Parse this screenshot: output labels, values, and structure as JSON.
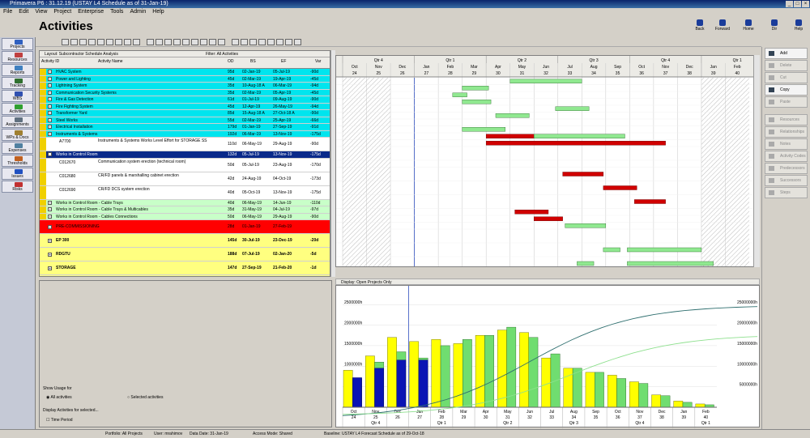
{
  "window": {
    "title": "Primavera P6 : 31.12.19 (USTAY L4 Schedule as of 31-Jan-19)"
  },
  "menu": [
    "File",
    "Edit",
    "View",
    "Project",
    "Enterprise",
    "Tools",
    "Admin",
    "Help"
  ],
  "page": {
    "title": "Activities"
  },
  "header_buttons": [
    {
      "label": "Back",
      "name": "back-button"
    },
    {
      "label": "Forward",
      "name": "forward-button"
    },
    {
      "label": "Home",
      "name": "home-button"
    },
    {
      "label": "Dir",
      "name": "directory-button"
    },
    {
      "label": "Help",
      "name": "help-button"
    }
  ],
  "nav": [
    {
      "label": "Projects",
      "color": "#3060c0"
    },
    {
      "label": "Resources",
      "color": "#c04040"
    },
    {
      "label": "Reports",
      "color": "#4080c0"
    },
    {
      "label": "Tracking",
      "color": "#307030"
    },
    {
      "label": "WBS",
      "color": "#3050b0"
    },
    {
      "label": "Activities",
      "color": "#30a030"
    },
    {
      "label": "Assignments",
      "color": "#607080"
    },
    {
      "label": "WPs & Docs",
      "color": "#a08030"
    },
    {
      "label": "Expenses",
      "color": "#5080a0"
    },
    {
      "label": "Thresholds",
      "color": "#c06020"
    },
    {
      "label": "Issues",
      "color": "#2050c0"
    },
    {
      "label": "Risks",
      "color": "#c03030"
    }
  ],
  "right_actions": [
    {
      "label": "Add",
      "enabled": true
    },
    {
      "label": "Delete",
      "enabled": false
    },
    {
      "label": "Cut",
      "enabled": false
    },
    {
      "label": "Copy",
      "enabled": true
    },
    {
      "label": "Paste",
      "enabled": false
    },
    {
      "label": "Resources",
      "enabled": false
    },
    {
      "label": "Relationships",
      "enabled": false
    },
    {
      "label": "Notes",
      "enabled": false
    },
    {
      "label": "Activity Codes",
      "enabled": false
    },
    {
      "label": "Predecessors",
      "enabled": false
    },
    {
      "label": "Successors",
      "enabled": false
    },
    {
      "label": "Steps",
      "enabled": false
    }
  ],
  "table": {
    "layout_label": "Layout: Subcontractor Schedule Analysis",
    "filter_label": "Filter: All Activities",
    "columns": [
      "Activity ID",
      "Activity Name",
      "OD",
      "BS",
      "EF",
      "Var"
    ],
    "rows": [
      {
        "id": "",
        "name": "HVAC System",
        "od": "95d",
        "bs": "02-Jan-19",
        "ef": "05-Jul-19",
        "var": "-90d",
        "bg": "#00e5ee",
        "stripe": "#f0d000"
      },
      {
        "id": "",
        "name": "Power and Lighting",
        "od": "45d",
        "bs": "02-Mar-19",
        "ef": "19-Apr-19",
        "var": "-45d",
        "bg": "#00e5ee",
        "stripe": "#f0d000"
      },
      {
        "id": "",
        "name": "Lightning System",
        "od": "35d",
        "bs": "10-Aug-18 A",
        "ef": "06-Mar-19",
        "var": "-94d",
        "bg": "#00e5ee",
        "stripe": "#f0d000"
      },
      {
        "id": "",
        "name": "Communication Security Systems",
        "od": "35d",
        "bs": "02-Mar-19",
        "ef": "05-Apr-19",
        "var": "-45d",
        "bg": "#00e5ee",
        "stripe": "#f0d000"
      },
      {
        "id": "",
        "name": "Fire & Gas Detection",
        "od": "61d",
        "bs": "01-Jul-19",
        "ef": "09-Aug-19",
        "var": "-90d",
        "bg": "#00e5ee",
        "stripe": "#f0d000"
      },
      {
        "id": "",
        "name": "Fire Fighting System",
        "od": "45d",
        "bs": "12-Apr-19",
        "ef": "26-May-19",
        "var": "-94d",
        "bg": "#00e5ee",
        "stripe": "#f0d000"
      },
      {
        "id": "",
        "name": "Transformer Yard",
        "od": "85d",
        "bs": "15-Aug-18 A",
        "ef": "27-Oct-18 A",
        "var": "-90d",
        "bg": "#00e5ee",
        "stripe": "#f0d000"
      },
      {
        "id": "",
        "name": "Steel Works",
        "od": "55d",
        "bs": "02-Mar-19",
        "ef": "25-Apr-19",
        "var": "-66d",
        "bg": "#00e5ee",
        "stripe": "#f0d000"
      },
      {
        "id": "",
        "name": "Electrical Installation",
        "od": "179d",
        "bs": "01-Jan-19",
        "ef": "27-Sep-19",
        "var": "-91d",
        "bg": "#00e5ee",
        "stripe": "#f0d000"
      },
      {
        "id": "",
        "name": "Instruments & Systems",
        "od": "192d",
        "bs": "06-Mar-19",
        "ef": "13-Nov-19",
        "var": "-175d",
        "bg": "#00e5ee",
        "stripe": "#f0d000"
      },
      {
        "id": "A7700",
        "name": "Instruments & Systems Works Level Effort for STORAGE SS",
        "od": "110d",
        "bs": "06-May-19",
        "ef": "29-Aug-19",
        "var": "-90d",
        "bg": "#ffffff",
        "stripe": "#f0d000",
        "tall": true
      },
      {
        "id": "",
        "name": "Works in Control Room",
        "od": "132d",
        "bs": "05-Jul-19",
        "ef": "13-Nov-19",
        "var": "-175d",
        "bg": "#0a2a8a",
        "stripe": "#f0d000",
        "dark": true
      },
      {
        "id": "C012670",
        "name": "Communication system erection (technical room)",
        "od": "50d",
        "bs": "05-Jul-19",
        "ef": "23-Aug-19",
        "var": "-170d",
        "bg": "#ffffff",
        "stripe": "#f0d000",
        "tall": true
      },
      {
        "id": "C012680",
        "name": "CR/FD panels & marshalling cabinet erection",
        "od": "42d",
        "bs": "24-Aug-19",
        "ef": "04-Oct-19",
        "var": "-173d",
        "bg": "#ffffff",
        "stripe": "#f0d000",
        "tall": true
      },
      {
        "id": "C012690",
        "name": "CR/FD DCS system erection",
        "od": "40d",
        "bs": "05-Oct-19",
        "ef": "13-Nov-19",
        "var": "-175d",
        "bg": "#ffffff",
        "stripe": "#f0d000",
        "tall": true
      },
      {
        "id": "",
        "name": "Works in Control Room - Cable Trays",
        "od": "40d",
        "bs": "06-May-19",
        "ef": "14-Jun-19",
        "var": "-110d",
        "bg": "#c8ffc8",
        "stripe": "#f0d000"
      },
      {
        "id": "",
        "name": "Works in Control Room - Cable Trays & Multicables",
        "od": "35d",
        "bs": "31-May-19",
        "ef": "04-Jul-19",
        "var": "-97d",
        "bg": "#c8ffc8",
        "stripe": "#f0d000"
      },
      {
        "id": "",
        "name": "Works in Control Room - Cables Connections",
        "od": "50d",
        "bs": "06-May-19",
        "ef": "29-Aug-19",
        "var": "-90d",
        "bg": "#c8ffc8",
        "stripe": "#f0d000"
      },
      {
        "id": "",
        "name": "PRE-COMMISSIONING",
        "od": "28d",
        "bs": "01-Jan-19",
        "ef": "27-Feb-19",
        "var": "",
        "bg": "#ff0000",
        "stripe": "#ff0000",
        "tall2": true
      },
      {
        "id": "",
        "name": "EP 300",
        "od": "145d",
        "bs": "30-Jul-19",
        "ef": "23-Dec-19",
        "var": "-20d",
        "bg": "#ffff80",
        "stripe": "#ffff80",
        "tall2": true,
        "bold": true
      },
      {
        "id": "",
        "name": "RDGTU",
        "od": "188d",
        "bs": "07-Jul-19",
        "ef": "02-Jan-20",
        "var": "-5d",
        "bg": "#ffff80",
        "stripe": "#ffff80",
        "tall2": true,
        "bold": true
      },
      {
        "id": "",
        "name": "STORAGE",
        "od": "147d",
        "bs": "27-Sep-19",
        "ef": "21-Feb-20",
        "var": "-1d",
        "bg": "#ffff80",
        "stripe": "#ffff80",
        "tall2": true,
        "bold": true
      },
      {
        "id": "",
        "name": "INTERCONNECTING PR EP300 - STORAGE",
        "od": "0d",
        "bs": "22-Sep-19",
        "ef": "22-Sep-19",
        "var": "",
        "bg": "#ffff80",
        "stripe": "#ffff80",
        "tall2": true,
        "bold": true
      }
    ]
  },
  "gantt": {
    "quarters": [
      "Qtr 4",
      "Qtr 1",
      "Qtr 2",
      "Qtr 3",
      "Qtr 4",
      "Qtr 1"
    ],
    "months": [
      "Oct",
      "Nov",
      "Dec",
      "Jan",
      "Feb",
      "Mar",
      "Apr",
      "May",
      "Jun",
      "Jul",
      "Aug",
      "Sep",
      "Oct",
      "Nov",
      "Dec",
      "Jan",
      "Feb"
    ],
    "weeks": [
      "24",
      "25",
      "26",
      "27",
      "28",
      "29",
      "30",
      "31",
      "32",
      "33",
      "34",
      "35",
      "36",
      "37",
      "38",
      "39",
      "40"
    ],
    "bars": [
      {
        "row": 0,
        "start": 7.0,
        "end": 10.0,
        "color": "#90e890"
      },
      {
        "row": 1,
        "start": 5.0,
        "end": 6.1,
        "color": "#90e890"
      },
      {
        "row": 2,
        "start": 4.6,
        "end": 5.2,
        "color": "#90e890"
      },
      {
        "row": 3,
        "start": 5.0,
        "end": 6.2,
        "color": "#90e890"
      },
      {
        "row": 4,
        "start": 8.9,
        "end": 10.3,
        "color": "#90e890"
      },
      {
        "row": 5,
        "start": 6.4,
        "end": 7.8,
        "color": "#90e890"
      },
      {
        "row": 7,
        "start": 5.0,
        "end": 6.8,
        "color": "#90e890"
      },
      {
        "row": 8,
        "start": 6.0,
        "end": 11.8,
        "color": "#90e890",
        "redUntil": 8.0
      },
      {
        "row": 9,
        "start": 6.0,
        "end": 13.5,
        "color": "#d00000"
      },
      {
        "row": 12,
        "start": 9.2,
        "end": 10.9,
        "color": "#d00000"
      },
      {
        "row": 13,
        "start": 10.9,
        "end": 12.3,
        "color": "#d00000"
      },
      {
        "row": 14,
        "start": 12.2,
        "end": 13.5,
        "color": "#d00000"
      },
      {
        "row": 15,
        "start": 7.2,
        "end": 8.6,
        "color": "#d00000"
      },
      {
        "row": 16,
        "start": 8.0,
        "end": 9.2,
        "color": "#d00000"
      },
      {
        "row": 17,
        "start": 9.3,
        "end": 11.0,
        "color": "#90e890"
      },
      {
        "row": 19,
        "start": 10.9,
        "end": 11.6,
        "color": "#90e890"
      },
      {
        "row": 19,
        "start": 11.9,
        "end": 15.0,
        "color": "#90e890"
      },
      {
        "row": 20,
        "start": 9.8,
        "end": 10.5,
        "color": "#90e890"
      },
      {
        "row": 20,
        "start": 11.9,
        "end": 15.5,
        "color": "#90e890"
      },
      {
        "row": 21,
        "start": 11.9,
        "end": 12.8,
        "color": "#90e890"
      },
      {
        "row": 21,
        "start": 13.4,
        "end": 17.0,
        "color": "#d00000"
      }
    ]
  },
  "histogram": {
    "display_label": "Display: Open Projects Only",
    "left_ticks": [
      "2500000h",
      "2000000h",
      "1500000h",
      "1000000h",
      "500000h"
    ],
    "right_ticks": [
      "25000000h",
      "20000000h",
      "15000000h",
      "10000000h",
      "5000000h"
    ],
    "x_months": [
      "Oct",
      "Nov",
      "Dec",
      "Jan",
      "Feb",
      "Mar",
      "Apr",
      "May",
      "Jun",
      "Jul",
      "Aug",
      "Sep",
      "Oct",
      "Nov",
      "Dec",
      "Jan",
      "Feb"
    ],
    "x_weeks": [
      "24",
      "25",
      "26",
      "27",
      "28",
      "29",
      "30",
      "31",
      "32",
      "33",
      "34",
      "35",
      "36",
      "37",
      "38",
      "39",
      "40"
    ],
    "x_quarters": [
      "Qtr 4",
      "Qtr 1",
      "Qtr 2",
      "Qtr 3",
      "Qtr 4",
      "Qtr 1"
    ]
  },
  "chart_data": {
    "type": "bar",
    "categories": [
      "Oct",
      "Nov",
      "Dec",
      "Jan",
      "Feb",
      "Mar",
      "Apr",
      "May",
      "Jun",
      "Jul",
      "Aug",
      "Sep",
      "Oct",
      "Nov",
      "Dec",
      "Jan",
      "Feb"
    ],
    "series": [
      {
        "values": [
          900000,
          1250000,
          1700000,
          1600000,
          1650000,
          1550000,
          1750000,
          1880000,
          1820000,
          1200000,
          950000,
          850000,
          780000,
          620000,
          300000,
          150000,
          80000
        ]
      },
      {
        "values": [
          700000,
          1100000,
          1350000,
          1200000,
          1500000,
          1650000,
          1750000,
          1950000,
          1700000,
          1300000,
          950000,
          850000,
          700000,
          580000,
          280000,
          120000,
          60000
        ]
      },
      {
        "values": [
          720000,
          950000,
          1150000,
          1150000,
          0,
          0,
          0,
          0,
          0,
          0,
          0,
          0,
          0,
          0,
          0,
          0,
          0
        ]
      }
    ],
    "ylim": [
      0,
      2800000
    ]
  },
  "usage": {
    "show_usage_for": "Show Usage for",
    "all_activities": "All activities",
    "selected_activities": "Selected activities",
    "display_activities": "Display Activities for selected...",
    "time_period": "Time Period"
  },
  "status": {
    "portfolio": "Portfolio: All Projects",
    "user": "User: mrahimov",
    "date": "Data Date: 31-Jan-19",
    "access": "Access Mode: Shared",
    "baseline": "Baseline: USTAY L4 Forecast Schedule as of 29-Oct-18"
  }
}
